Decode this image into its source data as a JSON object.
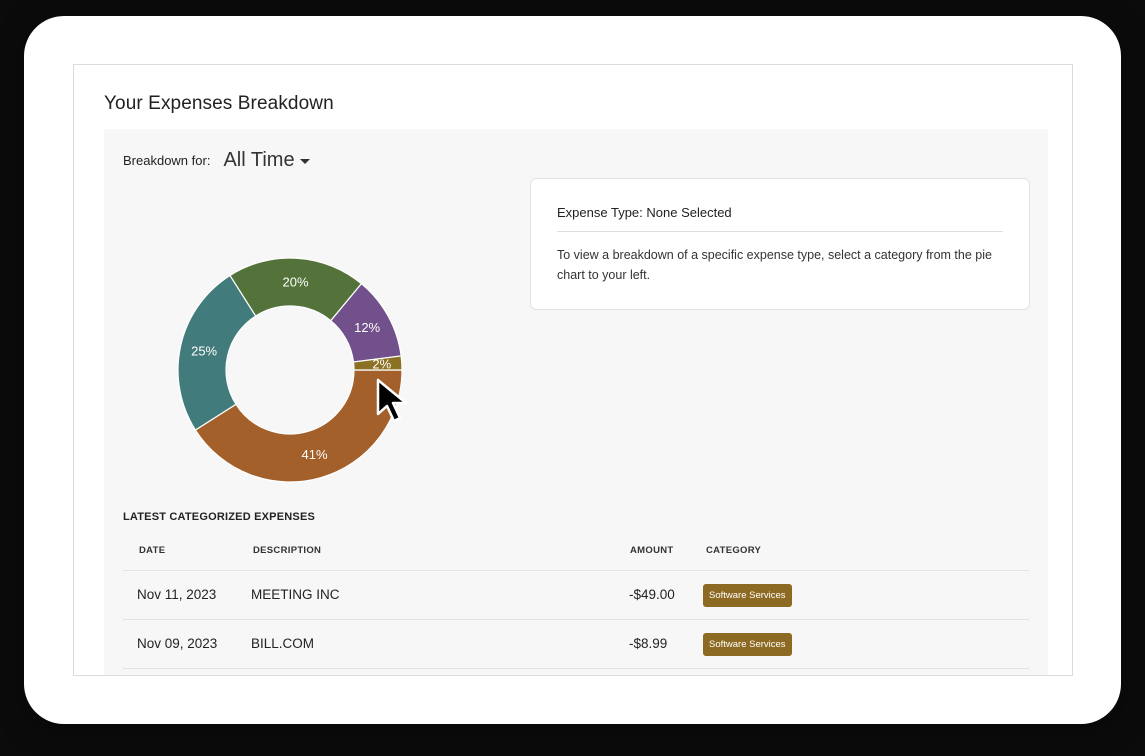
{
  "page": {
    "title": "Your Expenses Breakdown"
  },
  "breakdown": {
    "label": "Breakdown for:",
    "period": "All Time"
  },
  "info": {
    "title": "Expense Type: None Selected",
    "text": "To view a breakdown of a specific expense type, select a category from the pie chart to your left."
  },
  "chart_data": {
    "type": "pie",
    "slices": [
      {
        "label": "41%",
        "value": 41,
        "color": "#a4602a"
      },
      {
        "label": "25%",
        "value": 25,
        "color": "#427b7b"
      },
      {
        "label": "20%",
        "value": 20,
        "color": "#53733a"
      },
      {
        "label": "12%",
        "value": 12,
        "color": "#72508b"
      },
      {
        "label": "2%",
        "value": 2,
        "color": "#8b7124"
      }
    ]
  },
  "expenses": {
    "heading": "LATEST CATEGORIZED EXPENSES",
    "columns": {
      "date": "DATE",
      "description": "DESCRIPTION",
      "amount": "AMOUNT",
      "category": "CATEGORY"
    },
    "rows": [
      {
        "date": "Nov 11, 2023",
        "description": "MEETING INC",
        "amount": "-$49.00",
        "category": "Software Services"
      },
      {
        "date": "Nov 09, 2023",
        "description": "BILL.COM",
        "amount": "-$8.99",
        "category": "Software Services"
      }
    ]
  },
  "colors": {
    "badge": "#8d6a23",
    "panel_bg": "#f7f7f7"
  }
}
